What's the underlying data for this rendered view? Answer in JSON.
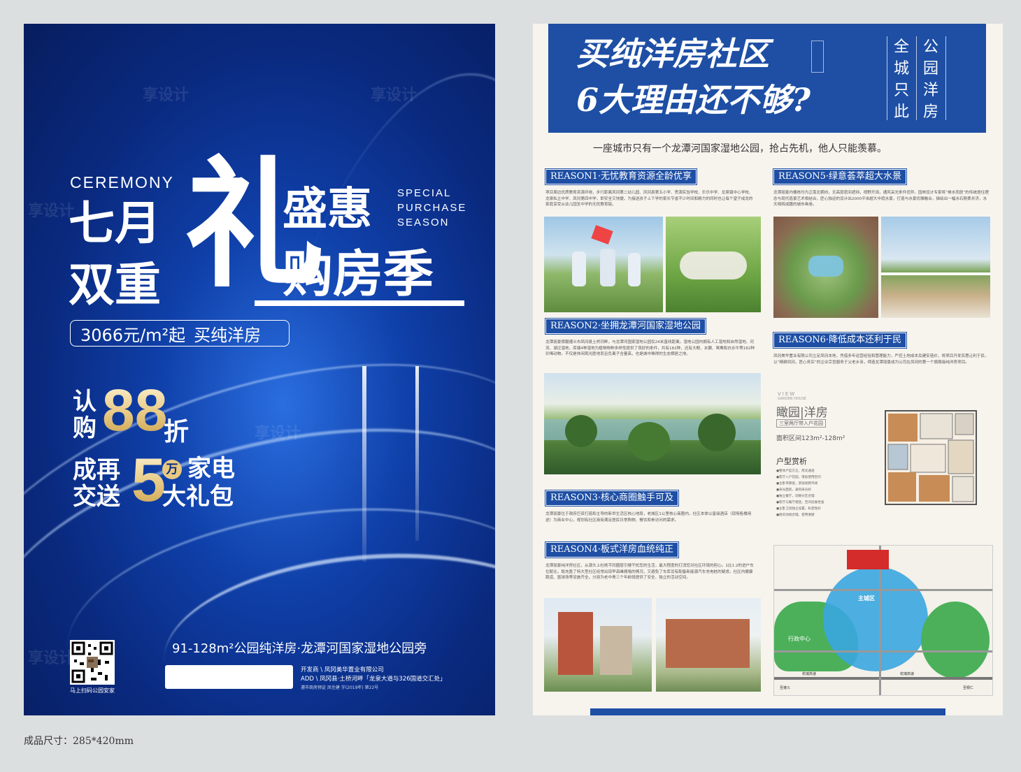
{
  "left_poster": {
    "ceremony": "CEREMONY",
    "title_left_top": "七月",
    "title_left_bottom": "双重",
    "title_big_char": "礼",
    "title_right_top": "盛惠",
    "title_right_bottom": "购房季",
    "special_lines": [
      "SPECIAL",
      "PURCHASE",
      "SEASON"
    ],
    "price": "3066元/m²起",
    "price_suffix": "买纯洋房",
    "offer1_left": "认购",
    "offer1_num": "88",
    "offer1_unit": "折",
    "offer2_left_top": "成再",
    "offer2_left_bottom": "交送",
    "offer2_num": "5",
    "offer2_badge": "万",
    "offer2_right_top": "家电",
    "offer2_right_bottom": "大礼包",
    "footer_line": "91-128m²公园纯洋房·龙潭河国家湿地公园旁",
    "developer": "开发商 \\ 凤冈美华置业有限公司",
    "address": "ADD \\ 凤冈县·土桥河畔「龙泉大道与326国道交汇处」",
    "license": "遵市商房预证 凤住建 字(2019年) 第22号",
    "qr_caption": "马上扫码公园安家"
  },
  "right_sheet": {
    "headline_line1": "买纯洋房社区",
    "headline_line2": "6大理由还不够?",
    "vertical_col1": "全城只此",
    "vertical_col2": "公园洋房",
    "subtitle": "一座城市只有一个龙潭河国家湿地公园，抢占先机，他人只能羡慕。",
    "reasons": [
      {
        "title": "REASON1·无忧教育资源全龄优享",
        "text": "项目周边优质教育资源环绕，步行距离凤冈第二幼儿园、凤冈县第五小学、思源实验学校、乐乐中学、龙泉镇中心学校、龙泉私立中学、凤冈第四中学，即安全又快捷，为接送孩子上下学的家长节省不少时间和精力的同时也让每个望子成龙的家庭享受从幼儿园至中学的无忧教育链。"
      },
      {
        "title": "REASON2·坐拥龙潭河国家湿地公园",
        "text": "龙潭丽景傍踞遵义市凤冈县土桥河畔，与龙潭河国家湿地公园仅24米直线距离。湿地公园内拥有人工湿地和自然湿地、河流、湖泛湿地、库塘4种湿地为植物物种多样性提供了良好的条件，共有182种，还有大鲵、水獭、鸳鸯和白水牛等182种珍稀动物。不仅是休闲观光胜地而且负离子含量高，也是城中难得的生态栖居之地。"
      },
      {
        "title": "REASON3·核心商圈触手可及",
        "text": "龙潭丽景位于政府巨资打造和主导的新世生活区核心地段，老城区1公里核心商圈内，社区本体以星级酒店（现场售楼用途）为商业中心，规划有社区商街满足居民日常购物、餐饮和参访问的需求。"
      },
      {
        "title": "REASON4·板式洋房血统纯正",
        "text": "龙潭丽景纯洋房社区，从源头上杜绝不同圈层引楼干扰您的生活，最大程度的打消您对社区环境的担心。1比1.2的进户车位配比，既充盈了特大型社区经常出现早高峰拥堵的情况，又避免了车库设有配备新能源汽车充电桩的疑虑，社区内健康跑道、篮球场等设施齐全，分别为老中青三个年龄段提供了安全、独立的活动空间。"
      },
      {
        "title": "REASON5·绿意荟萃超大水景",
        "text": "龙潭丽景内楼栋均为正南北朝向，无高层密间遮挡，视野开阔，通风采光条件优异。园林设计专家将“禅水而居”的传统居住理念与现代造景艺术相结合，匠心独运的设计出2000平米超大中庭水景，打造与水景优雅融合，描绘出一幅水石刚柔并济，水天相辉成趣的城市画卷。"
      },
      {
        "title": "REASON6·降低成本还利于民",
        "text": "凤冈美华置业有限公司立足凤冈本地，凭借多年运营经验和管理能力，严控土地成本及建安造价，将项目开发实惠让利于民，以“精耕凤冈，匠心务实”的企业宗旨服务于父老乡亲，缔造龙潭丽景成为公司在凤冈的第一个旗舰级纯洋房项目。"
      }
    ],
    "floorplan": {
      "view_label": "VIEW",
      "view_sub": "GARDEN HOUSE",
      "title": "瞰园|洋房",
      "tag": "三室两厅带入户花园",
      "area": "面积区间123m²-128m²",
      "appreciate": "户型赏析",
      "bullets": [
        "●整体户型方正，南北通透",
        "●客厅入户花园，增加使用空间",
        "●主卧带飘窗，景观视野开阔",
        "●采光面宽，通风采光好",
        "●独立餐厅，动静分区合理",
        "●客厅与餐厅相连，空间延展性强",
        "●主卧卫浴独立设置，私密性好",
        "●厨房动线合理，使用便捷"
      ]
    },
    "map_labels": [
      "主城区",
      "行政中心",
      "杭瑞高速",
      "杭瑞高速",
      "至遵义",
      "至桐仁"
    ],
    "size_caption": "成品尺寸：285*420mm"
  },
  "colors": {
    "brand_blue": "#1e4fa5",
    "gold": "#e8c983",
    "poster_bg": "#0a2a80"
  }
}
